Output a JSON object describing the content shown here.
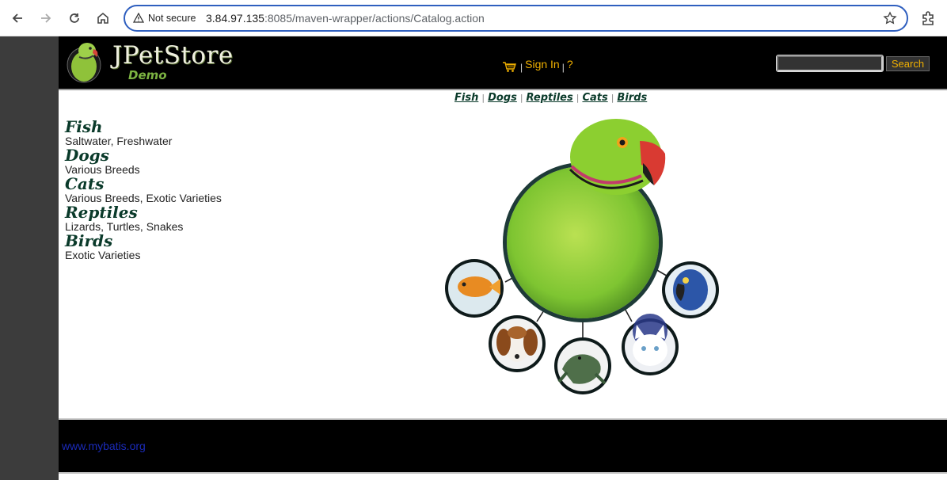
{
  "browser": {
    "security_label": "Not secure",
    "url_host": "3.84.97.135",
    "url_path": ":8085/maven-wrapper/actions/Catalog.action",
    "icons": [
      "back-arrow-icon",
      "forward-arrow-icon",
      "reload-icon",
      "home-icon",
      "warning-icon",
      "star-icon",
      "extensions-icon"
    ]
  },
  "header": {
    "logo_title": "JPetStore",
    "logo_subtitle": "Demo",
    "sign_in": "Sign In",
    "help": "?",
    "separator": "|",
    "search_value": "",
    "search_button": "Search"
  },
  "quick_links": [
    {
      "label": "Fish"
    },
    {
      "label": "Dogs"
    },
    {
      "label": "Reptiles"
    },
    {
      "label": "Cats"
    },
    {
      "label": "Birds"
    }
  ],
  "categories": [
    {
      "name": "Fish",
      "description": "Saltwater, Freshwater"
    },
    {
      "name": "Dogs",
      "description": "Various Breeds"
    },
    {
      "name": "Cats",
      "description": "Various Breeds, Exotic Varieties"
    },
    {
      "name": "Reptiles",
      "description": "Lizards, Turtles, Snakes"
    },
    {
      "name": "Birds",
      "description": "Exotic Varieties"
    }
  ],
  "footer": {
    "link": "www.mybatis.org"
  },
  "colors": {
    "header_bg": "#000000",
    "accent_gold": "#f0b000",
    "category_green": "#0a3a2a",
    "footer_link": "#1a2ab8"
  }
}
